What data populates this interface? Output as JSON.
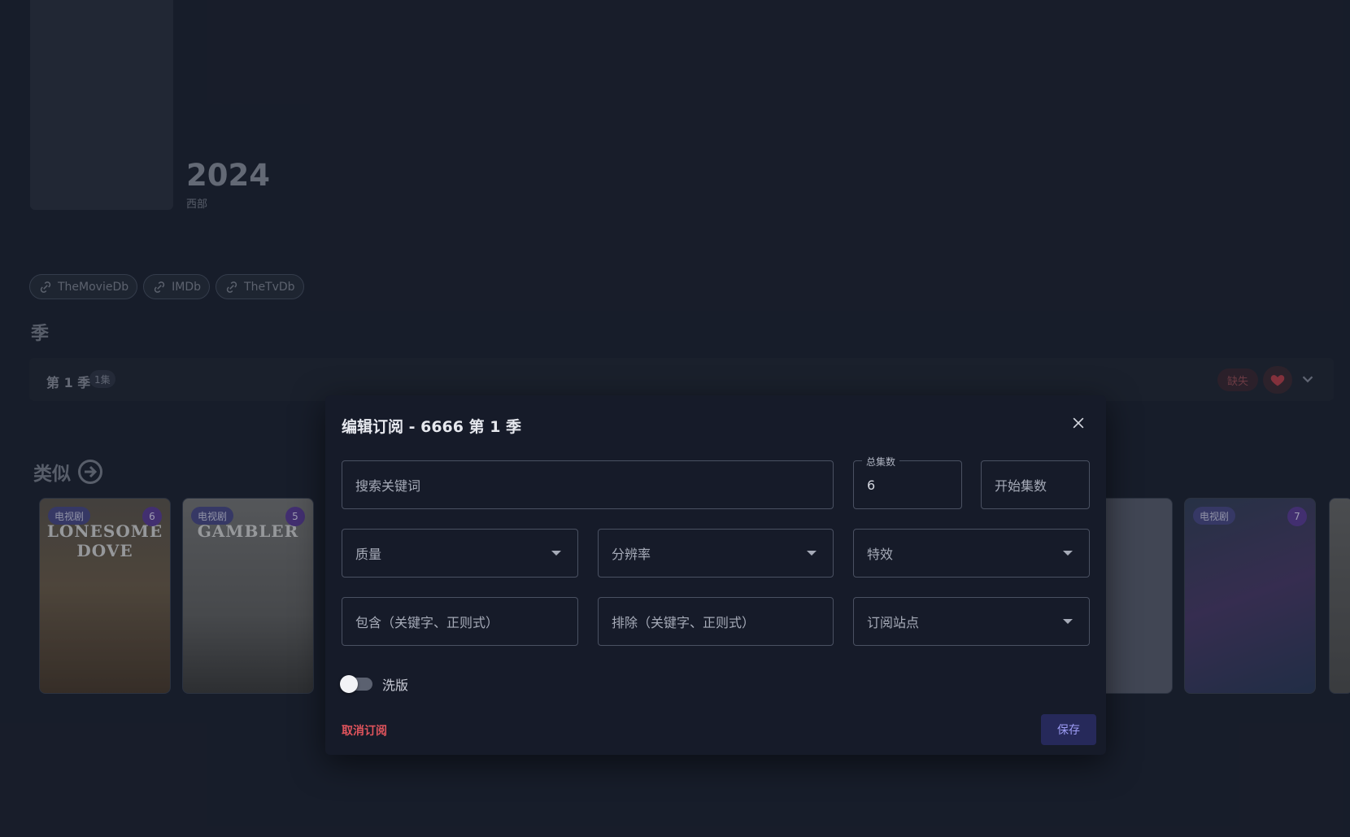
{
  "media": {
    "year": "2024",
    "genre": "西部"
  },
  "links": [
    {
      "label": "TheMovieDb",
      "icon": "link-icon"
    },
    {
      "label": "IMDb",
      "icon": "link-icon"
    },
    {
      "label": "TheTvDb",
      "icon": "link-icon"
    }
  ],
  "seasons": {
    "heading": "季",
    "row": {
      "name": "第 1 季",
      "count": "1集",
      "status": "缺失"
    }
  },
  "similar": {
    "heading": "类似",
    "cards": [
      {
        "type": "电视剧",
        "count": "6",
        "title": "LONESOME DOVE"
      },
      {
        "type": "电视剧",
        "count": "5",
        "title": "GAMBLER"
      },
      {
        "type": "电视剧",
        "count": "7"
      }
    ]
  },
  "dialog": {
    "title": "编辑订阅 - 6666 第 1 季",
    "fields": {
      "keyword_placeholder": "搜索关键词",
      "total_label": "总集数",
      "total_value": "6",
      "start_placeholder": "开始集数",
      "quality_placeholder": "质量",
      "resolution_placeholder": "分辨率",
      "effect_placeholder": "特效",
      "include_placeholder": "包含（关键字、正则式）",
      "exclude_placeholder": "排除（关键字、正则式）",
      "sites_placeholder": "订阅站点"
    },
    "switch_label": "洗版",
    "switch_on": false,
    "unsubscribe_label": "取消订阅",
    "save_label": "保存"
  },
  "colors": {
    "accent": "#9d9cf5",
    "danger": "#e0545c",
    "background": "#1b2130",
    "dialog": "#161b29"
  }
}
